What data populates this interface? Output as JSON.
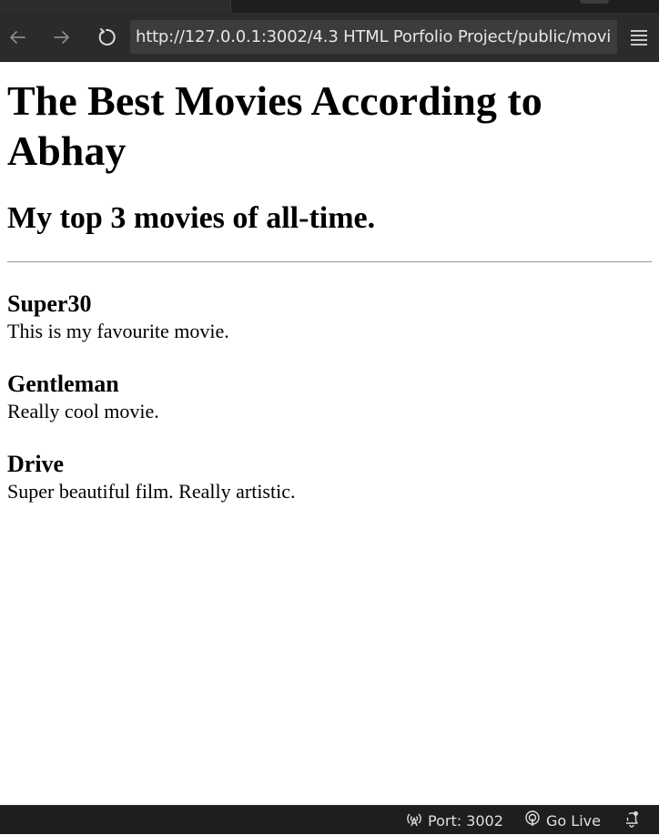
{
  "browser": {
    "url": "http://127.0.0.1:3002/4.3 HTML Porfolio Project/public/movi",
    "back_icon": "arrow-left-icon",
    "forward_icon": "arrow-right-icon",
    "reload_icon": "reload-icon",
    "menu_icon": "hamburger-menu-icon"
  },
  "page": {
    "title": "The Best Movies According to Abhay",
    "subtitle": "My top 3 movies of all-time.",
    "movies": [
      {
        "title": "Super30",
        "description": "This is my favourite movie."
      },
      {
        "title": "Gentleman",
        "description": "Really cool movie."
      },
      {
        "title": "Drive",
        "description": "Super beautiful film. Really artistic."
      }
    ]
  },
  "statusbar": {
    "port_label": "Port: 3002",
    "go_live_label": "Go Live",
    "port_icon": "broadcast-icon",
    "go_live_icon": "live-signal-icon",
    "notification_icon": "bell-icon"
  },
  "colors": {
    "toolbar_bg": "#2b2b2b",
    "url_bg": "#3c3c3c",
    "statusbar_bg": "#1e1e1e"
  }
}
